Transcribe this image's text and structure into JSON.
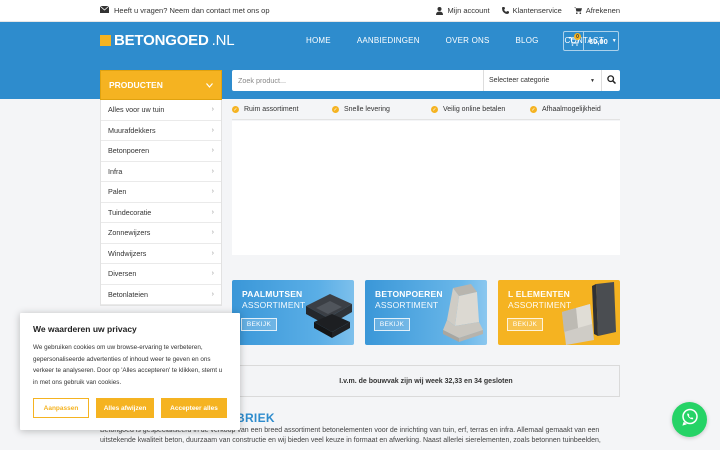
{
  "topbar": {
    "contact_text": "Heeft u vragen? Neem dan contact met ons op",
    "account": "Mijn account",
    "service": "Klantenservice",
    "checkout": "Afrekenen"
  },
  "header": {
    "logo_main": "BETONGOED",
    "logo_suffix": ".NL",
    "nav": [
      "HOME",
      "AANBIEDINGEN",
      "OVER ONS",
      "BLOG",
      "CONTACT"
    ],
    "cart_count": "0",
    "cart_amount": "€0,00"
  },
  "products": {
    "title": "PRODUCTEN",
    "items": [
      "Alles voor uw tuin",
      "Muurafdekkers",
      "Betonpoeren",
      "Infra",
      "Palen",
      "Tuindecoratie",
      "Zonnewijzers",
      "Windwijzers",
      "Diversen",
      "Betonlateien"
    ]
  },
  "search": {
    "placeholder": "Zoek product...",
    "category": "Selecteer categorie"
  },
  "usps": [
    "Ruim assortiment",
    "Snelle levering",
    "Veilig online betalen",
    "Afhaalmogelijkheid"
  ],
  "tiles": [
    {
      "title": "PAALMUTSEN",
      "subtitle": "ASSORTIMENT",
      "button": "BEKIJK"
    },
    {
      "title": "BETONPOEREN",
      "subtitle": "ASSORTIMENT",
      "button": "BEKIJK"
    },
    {
      "title": "L ELEMENTEN",
      "subtitle": "ASSORTIMENT",
      "button": "BEKIJK"
    }
  ],
  "notice": "I.v.m. de bouwvak zijn wij week 32,33 en 34 gesloten",
  "heading_partial": "BRIEK",
  "intro": {
    "line1": "Betongoed is gespecialiseerd in de verkoop van een breed assortiment betonelementen voor de inrichting van tuin, erf, terras en infra. Allemaal gemaakt van een",
    "line2": "uitstekende kwaliteit beton, duurzaam van constructie en wij bieden veel keuze in formaat en afwerking. Naast allerlei sierelementen, zoals betonnen tuinbeelden,"
  },
  "cookie": {
    "title": "We waarderen uw privacy",
    "body": "We gebruiken cookies om uw browse-ervaring te verbeteren, gepersonaliseerde advertenties of inhoud weer te geven en ons verkeer te analyseren. Door op 'Alles accepteren' te klikken, stemt u in met ons gebruik van cookies.",
    "btn_customize": "Aanpassen",
    "btn_reject": "Alles afwijzen",
    "btn_accept": "Accepteer alles"
  },
  "colors": {
    "primary_blue": "#2e8ccd",
    "accent_yellow": "#f5b321",
    "whatsapp_green": "#25d366"
  }
}
